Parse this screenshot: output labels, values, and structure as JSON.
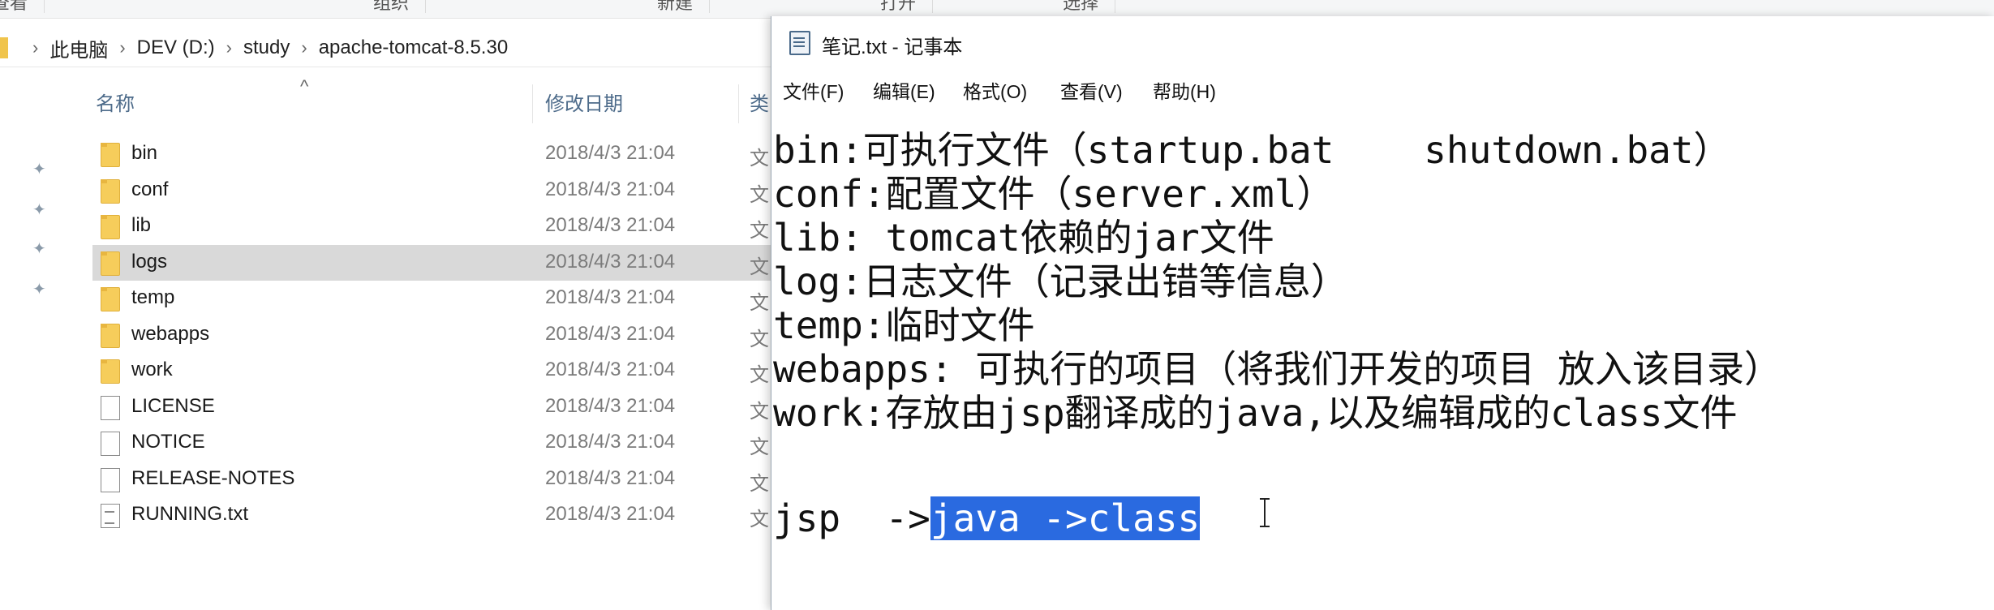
{
  "ribbon": {
    "items": [
      "查看",
      "组织",
      "新建",
      "打开",
      "选择"
    ]
  },
  "explorer": {
    "breadcrumb": [
      "此电脑",
      "DEV (D:)",
      "study",
      "apache-tomcat-8.5.30"
    ],
    "columns": {
      "name": "名称",
      "modified": "修改日期",
      "type": "类"
    },
    "files": [
      {
        "name": "bin",
        "date": "2018/4/3 21:04",
        "type": "文",
        "kind": "folder"
      },
      {
        "name": "conf",
        "date": "2018/4/3 21:04",
        "type": "文",
        "kind": "folder"
      },
      {
        "name": "lib",
        "date": "2018/4/3 21:04",
        "type": "文",
        "kind": "folder"
      },
      {
        "name": "logs",
        "date": "2018/4/3 21:04",
        "type": "文",
        "kind": "folder"
      },
      {
        "name": "temp",
        "date": "2018/4/3 21:04",
        "type": "文",
        "kind": "folder"
      },
      {
        "name": "webapps",
        "date": "2018/4/3 21:04",
        "type": "文",
        "kind": "folder"
      },
      {
        "name": "work",
        "date": "2018/4/3 21:04",
        "type": "文",
        "kind": "folder"
      },
      {
        "name": "LICENSE",
        "date": "2018/4/3 21:04",
        "type": "文",
        "kind": "file"
      },
      {
        "name": "NOTICE",
        "date": "2018/4/3 21:04",
        "type": "文",
        "kind": "file"
      },
      {
        "name": "RELEASE-NOTES",
        "date": "2018/4/3 21:04",
        "type": "文",
        "kind": "file"
      },
      {
        "name": "RUNNING.txt",
        "date": "2018/4/3 21:04",
        "type": "文",
        "kind": "txt"
      }
    ]
  },
  "notepad": {
    "title": "笔记.txt - 记事本",
    "menu": [
      "文件(F)",
      "编辑(E)",
      "格式(O)",
      "查看(V)",
      "帮助(H)"
    ],
    "lines": [
      "bin:可执行文件（startup.bat    shutdown.bat）",
      "conf:配置文件（server.xml）",
      "lib: tomcat依赖的jar文件",
      "log:日志文件（记录出错等信息）",
      "temp:临时文件",
      "webapps: 可执行的项目（将我们开发的项目 放入该目录）",
      "work:存放由jsp翻译成的java,以及编辑成的class文件"
    ],
    "last_line_prefix": "jsp  ->",
    "last_line_selected": "java ->class"
  }
}
